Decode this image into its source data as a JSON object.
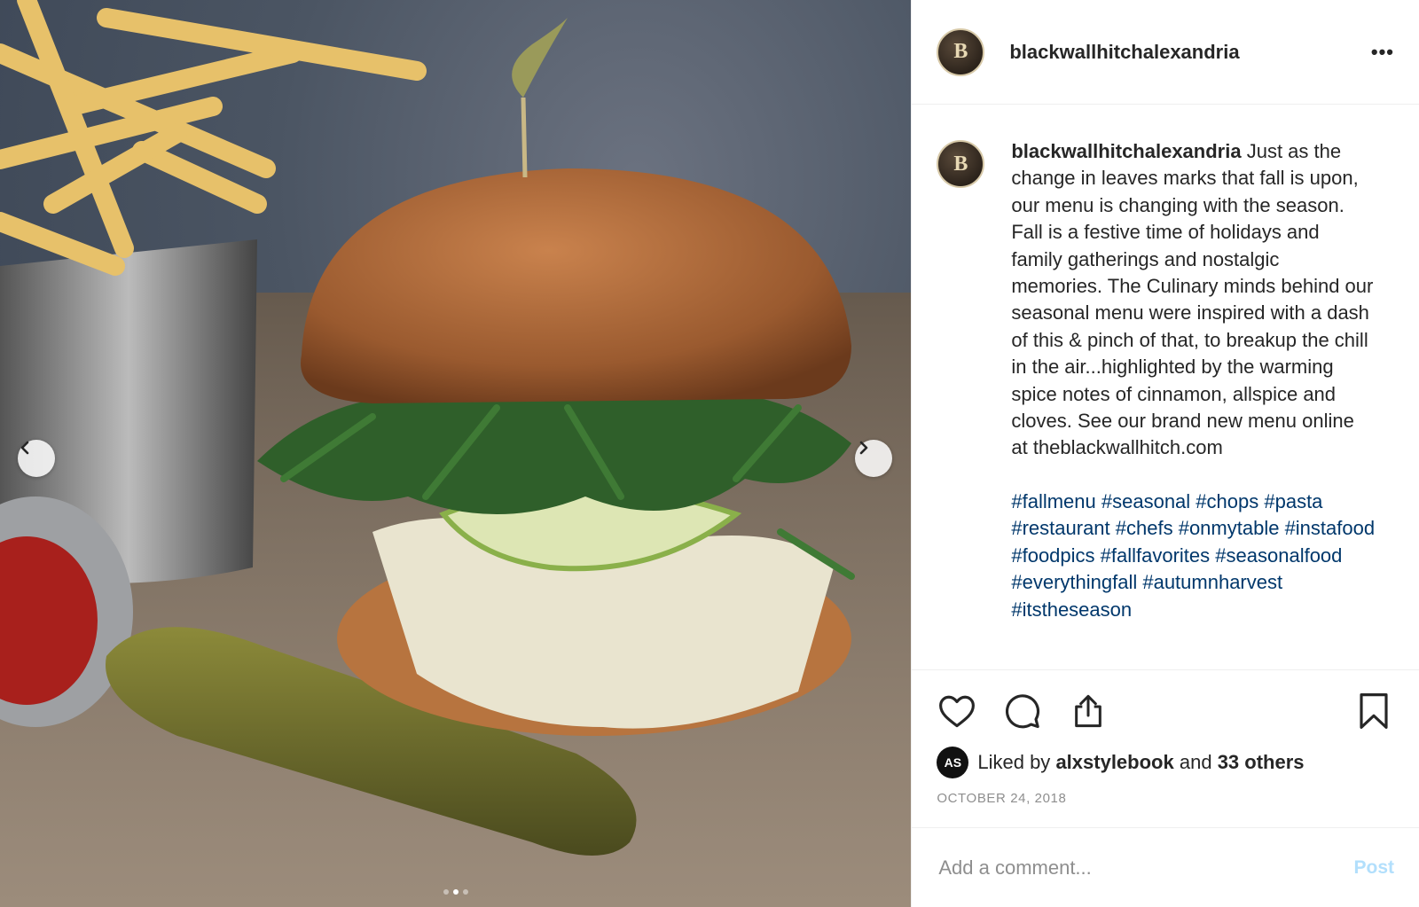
{
  "post": {
    "username": "blackwallhitchalexandria",
    "avatar_letter": "B",
    "more_label": "•••",
    "image_alt": "Sandwich with arugula, apple slices and melted cheese on a toasted bun, served with fries, ketchup and a pickle",
    "carousel": {
      "slides": 3,
      "active_index": 1
    }
  },
  "caption": {
    "username": "blackwallhitchalexandria",
    "text": "Just as the change in leaves marks that fall is upon, our menu is changing with the season. Fall is a festive time of holidays and family gatherings and nostalgic memories. The Culinary minds behind our seasonal menu were inspired with a dash of this & pinch of that, to breakup the chill in the air...highlighted by the warming spice notes of cinnamon, allspice and cloves. See our brand new menu online at theblackwallhitch.com",
    "hashtags": [
      "#fallmenu",
      "#seasonal",
      "#chops",
      "#pasta",
      "#restaurant",
      "#chefs",
      "#onmytable",
      "#instafood",
      "#foodpics",
      "#fallfavorites",
      "#seasonalfood",
      "#everythingfall",
      "#autumnharvest",
      "#itstheseason"
    ]
  },
  "icons": {
    "like": "heart-icon",
    "comment": "comment-bubble-icon",
    "share": "share-icon",
    "save": "bookmark-icon",
    "prev": "chevron-left-icon",
    "next": "chevron-right-icon"
  },
  "likes": {
    "liker_avatar_initials": "AS",
    "prefix": "Liked by",
    "liker": "alxstylebook",
    "conjunction": "and",
    "others": "33 others"
  },
  "date": "OCTOBER 24, 2018",
  "comment": {
    "placeholder": "Add a comment...",
    "post_label": "Post"
  },
  "colors": {
    "hashtag": "#00376b",
    "post_button_disabled": "#b2dffc",
    "muted_text": "#8e8e8e",
    "divider": "#efefef"
  }
}
